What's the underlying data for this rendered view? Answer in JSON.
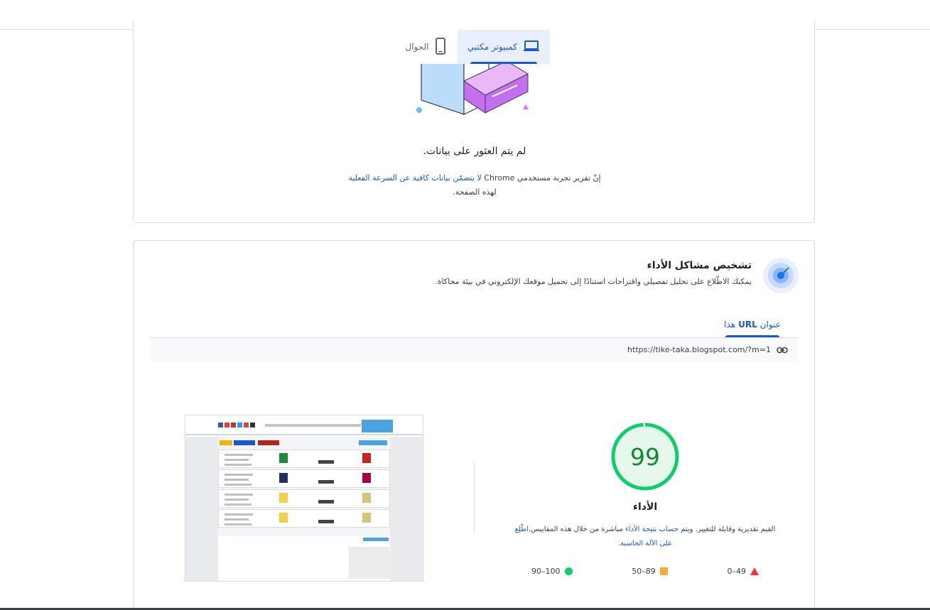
{
  "device_tabs": {
    "desktop_label": "كمبيوتر مكتبي",
    "mobile_label": "الجوال",
    "active": "desktop"
  },
  "no_data": {
    "title": "لم يتم العثور على بيانات.",
    "desc_prefix": "إنّ تقرير تجربة مستخدمي Chrome ",
    "desc_link": "لا يتضمّن بيانات كافية عن السرعة الفعلية",
    "desc_suffix": " لهذه الصفحة."
  },
  "diagnose": {
    "title": "تشخيص مشاكل الأداء",
    "desc": "يمكنك الاطّلاع على تحليل تفصيلي واقتراحات استنادًا إلى تحميل موقعك الإلكتروني في بيئة محاكاة.",
    "tab_prefix": "عنوان ",
    "tab_bold": "URL",
    "tab_suffix": " هذا",
    "url": "https://tike-taka.blogspot.com/?m=1"
  },
  "score": {
    "value": "99",
    "fraction": 0.99,
    "label": "الأداء",
    "desc_prefix": "القيم تقديرية وقابلة للتغيير. ويتم ",
    "desc_link1": "حساب نتيجة الأداء",
    "desc_middle": " مباشرة من خلال هذه المقاييس.",
    "desc_link2": "اطّلِع على الآلة الحاسبة."
  },
  "legend": {
    "fail": "0–49",
    "average": "50–89",
    "pass": "90–100"
  },
  "colors": {
    "accent": "#1a57c9",
    "pass": "#0cce6b",
    "pass_text": "#0d8a2f",
    "average": "#ffaa33",
    "fail": "#ff3333"
  },
  "icons": [
    "laptop-icon",
    "phone-icon",
    "gauge-target-icon",
    "link-icon"
  ]
}
